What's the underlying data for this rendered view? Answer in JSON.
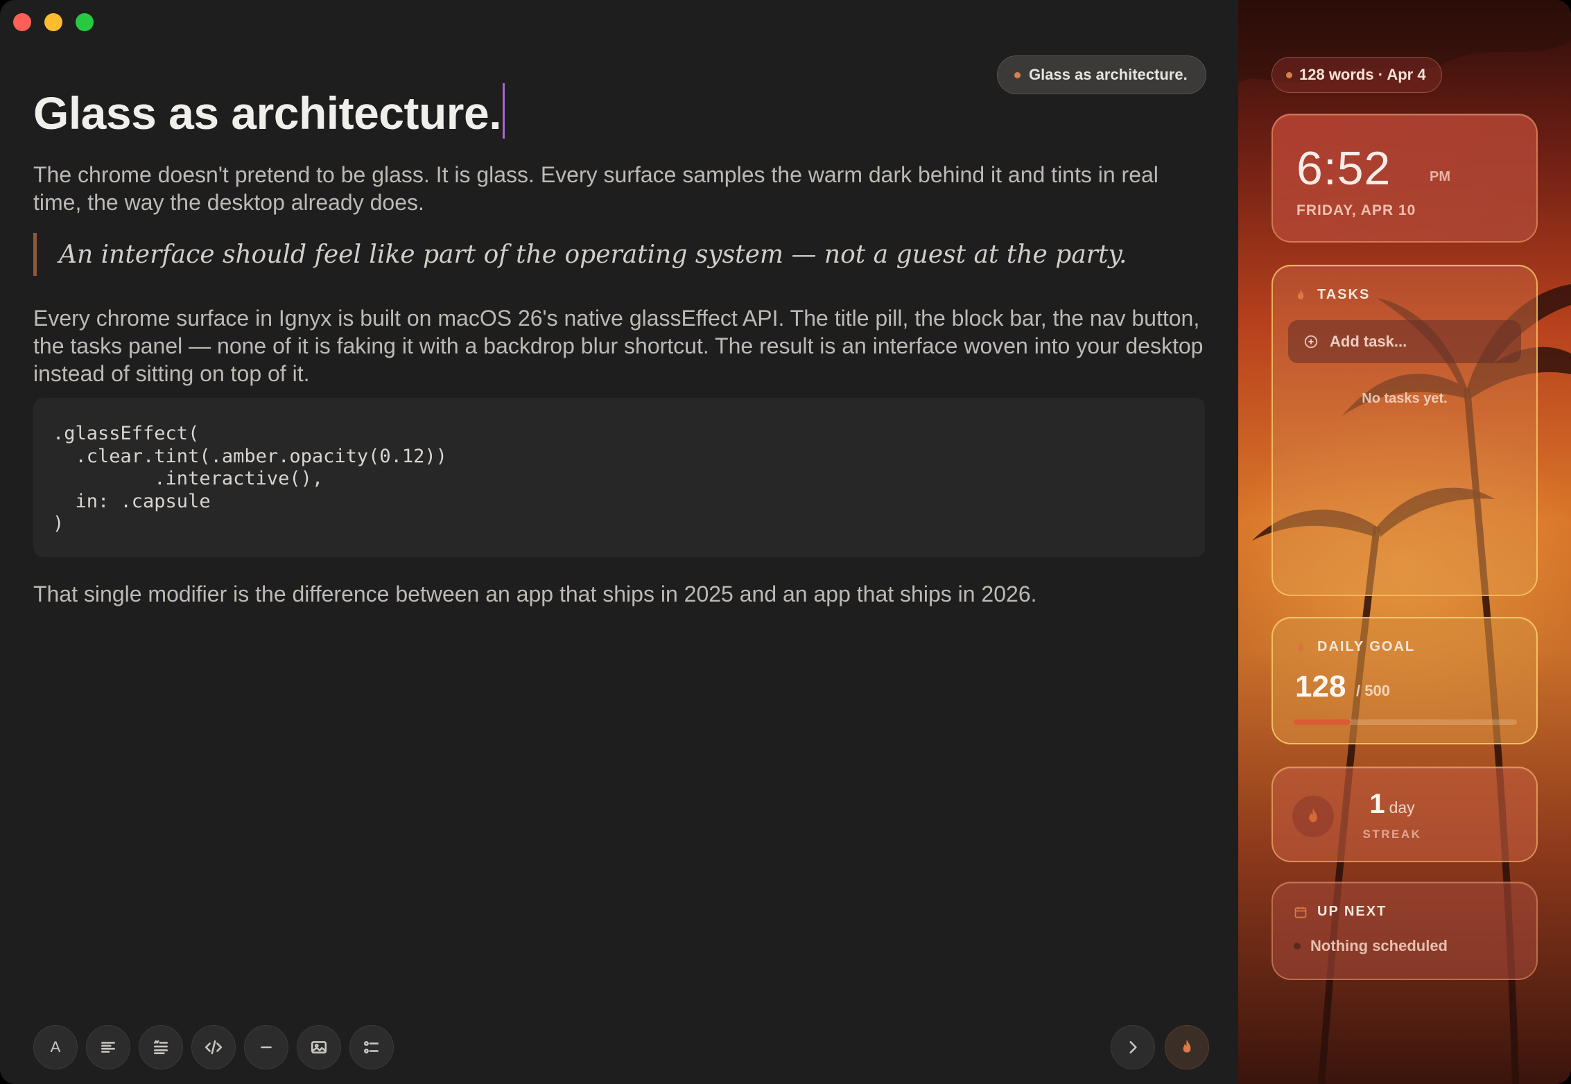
{
  "window": {
    "title_pill": "Glass as architecture."
  },
  "document": {
    "title": "Glass as architecture.",
    "paragraph1": "The chrome doesn't pretend to be glass. It is glass. Every surface samples the warm dark behind it and tints in real time, the way the desktop already does.",
    "quote": "An interface should feel like part of the operating system — not a guest at the party.",
    "paragraph2": "Every chrome surface in Ignyx is built on macOS 26's native glassEffect API. The title pill, the block bar, the nav button, the tasks panel — none of it is faking it with a backdrop blur shortcut. The result is an interface woven into your desktop instead of sitting on top of it.",
    "code": ".glassEffect(\n  .clear.tint(.amber.opacity(0.12))\n         .interactive(),\n  in: .capsule\n)",
    "paragraph3": "That single modifier is the difference between an app that ships in 2025 and an app that ships in 2026."
  },
  "toolbar": {
    "text_style_label": "A",
    "icons": [
      "text-style-icon",
      "paragraph-icon",
      "quote-icon",
      "code-icon",
      "divider-icon",
      "image-icon",
      "checklist-icon"
    ],
    "right_icons": [
      "chevron-right-icon",
      "flame-icon"
    ]
  },
  "sidebar": {
    "meta": "128 words · Apr 4",
    "clock": {
      "time": "6:52",
      "ampm": "PM",
      "date": "FRIDAY, APR 10"
    },
    "tasks": {
      "heading": "TASKS",
      "add_placeholder": "Add task...",
      "empty": "No tasks yet."
    },
    "goal": {
      "heading": "DAILY GOAL",
      "value": "128",
      "max": "/ 500",
      "progress": 0.256
    },
    "streak": {
      "count": "1",
      "unit": "day",
      "label": "STREAK"
    },
    "up_next": {
      "heading": "UP NEXT",
      "item": "Nothing scheduled"
    }
  },
  "colors": {
    "accent": "#d5804b",
    "caret": "#a667c9",
    "goal_fill": "#d95c35"
  }
}
